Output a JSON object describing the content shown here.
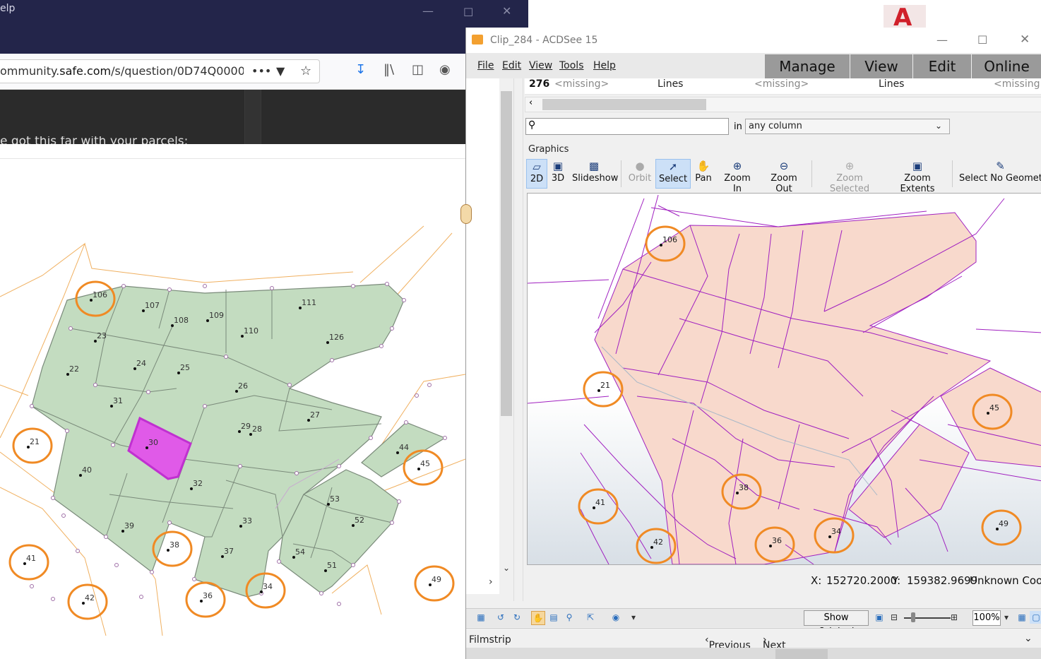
{
  "firefox": {
    "title_fragment": "elp",
    "url": "ommunity.safe.com/s/question/0D74Q00000",
    "url_domain": "safe.com",
    "page_text_fragment": "e got this far with your parcels:",
    "icons": [
      "more-icon",
      "pocket-icon",
      "bookmark-star-icon",
      "download-icon",
      "library-icon",
      "reader-view-icon",
      "account-icon"
    ]
  },
  "autocad": {
    "letter": "A",
    "color": "#d0202a"
  },
  "acdsee": {
    "title": "Clip_284 - ACDSee 15",
    "menu": [
      "File",
      "Edit",
      "View",
      "Tools",
      "Help"
    ],
    "modes": [
      "Manage",
      "View",
      "Edit",
      "Online"
    ],
    "table_row": {
      "id": "276",
      "c1": "<missing>",
      "c2": "Lines",
      "c3": "<missing>",
      "c4": "Lines",
      "c5": "<missing>"
    },
    "search": {
      "value": "",
      "in_label": "in",
      "column": "any column"
    },
    "graphics_label": "Graphics",
    "toolbar": [
      {
        "label": "2D",
        "icon": "2d-icon",
        "state": "selected"
      },
      {
        "label": "3D",
        "icon": "3d-icon",
        "state": "normal"
      },
      {
        "label": "Slideshow",
        "icon": "slideshow-icon",
        "state": "normal"
      },
      {
        "label": "Orbit",
        "icon": "orbit-icon",
        "state": "disabled"
      },
      {
        "label": "Select",
        "icon": "select-icon",
        "state": "selected"
      },
      {
        "label": "Pan",
        "icon": "pan-icon",
        "state": "normal"
      },
      {
        "label": "Zoom In",
        "icon": "zoom-in-icon",
        "state": "normal"
      },
      {
        "label": "Zoom Out",
        "icon": "zoom-out-icon",
        "state": "normal"
      },
      {
        "label": "Zoom Selected",
        "icon": "zoom-selected-icon",
        "state": "disabled"
      },
      {
        "label": "Zoom Extents",
        "icon": "zoom-extents-icon",
        "state": "normal"
      },
      {
        "label": "Select No Geometry",
        "icon": "select-no-geometry-icon",
        "state": "normal"
      }
    ],
    "coords": {
      "x_label": "X:",
      "x": "152720.2000",
      "y_label": "Y:",
      "y": "159382.9699",
      "crs": "Unknown Coord"
    },
    "bottom": {
      "show_original": "Show Original",
      "zoom": "100%"
    },
    "filmstrip": {
      "label": "Filmstrip",
      "previous": "Previous",
      "next": "Next"
    },
    "canvas_labels": [
      "106",
      "21",
      "45",
      "41",
      "38",
      "42",
      "36",
      "34",
      "49"
    ]
  },
  "parcel_map": {
    "labels": [
      "106",
      "107",
      "108",
      "109",
      "110",
      "111",
      "126",
      "23",
      "22",
      "24",
      "25",
      "26",
      "27",
      "31",
      "21",
      "30",
      "29",
      "28",
      "40",
      "32",
      "44",
      "45",
      "39",
      "38",
      "33",
      "53",
      "52",
      "37",
      "54",
      "51",
      "41",
      "42",
      "36",
      "34",
      "49"
    ],
    "fill_color": "#c3dcc0",
    "highlight_color": "#e05ae8",
    "circle_color": "#f08a24"
  }
}
